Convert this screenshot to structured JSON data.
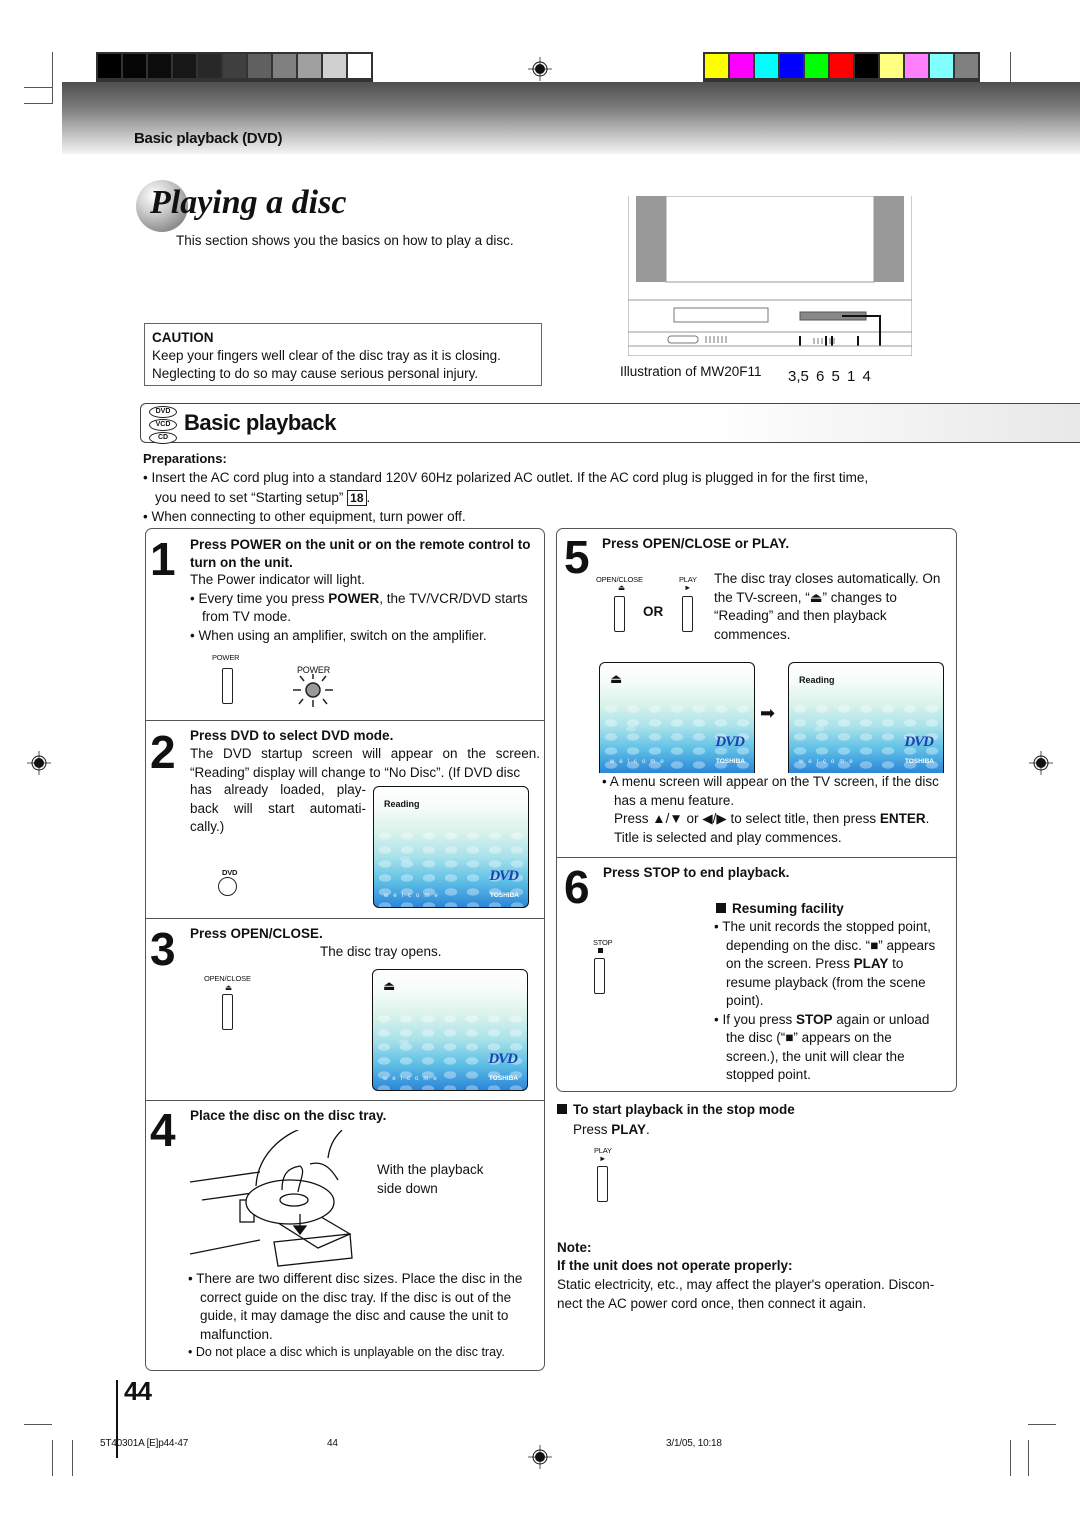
{
  "print_marks": {
    "grayscale_bar": [
      "#000000",
      "#050505",
      "#0c0c0c",
      "#171717",
      "#282828",
      "#404040",
      "#606060",
      "#808080",
      "#a0a0a0",
      "#d0d0d0",
      "#ffffff"
    ],
    "color_bar": [
      "#ffff00",
      "#ff00ff",
      "#00ffff",
      "#0000ff",
      "#00ff00",
      "#ff0000",
      "#000000",
      "#ffff80",
      "#ff80ff",
      "#80ffff",
      "#808080"
    ]
  },
  "header": {
    "section_label": "Basic playback (DVD)"
  },
  "intro": {
    "title": "Playing a disc",
    "subtitle": "This section shows you the basics on how to play a disc."
  },
  "caution": {
    "heading": "CAUTION",
    "line1": "Keep your fingers well clear of the disc tray as it is closing.",
    "line2": "Neglecting to do so may cause serious personal injury."
  },
  "illustration": {
    "caption": "Illustration of MW20F11",
    "callouts": "3,5   6 5 1   4"
  },
  "section": {
    "disc_tags": [
      "DVD",
      "VCD",
      "CD"
    ],
    "title": "Basic playback"
  },
  "preparations": {
    "heading": "Preparations:",
    "item1_a": "Insert the AC cord plug into a standard 120V 60Hz polarized AC outlet. If the AC cord plug is plugged in for the first time,",
    "item1_b": "you need to set “Starting setup”",
    "item1_ref": "18",
    "item2": "When connecting to other equipment, turn power off."
  },
  "steps": {
    "s1": {
      "number": "1",
      "heading_a": "Press POWER on the unit or on the remote control",
      "heading_b": "to turn on the unit",
      "text": "The Power indicator will light.",
      "bullet1_a": "Every time you press ",
      "bullet1_bold": "POWER",
      "bullet1_b": ", the TV/VCR/DVD starts from TV mode.",
      "bullet2": "When using an amplifier, switch on the amplifier.",
      "button_label": "POWER",
      "indicator_label": "POWER"
    },
    "s2": {
      "number": "2",
      "heading": "Press DVD to select DVD mode.",
      "text1": "The DVD startup screen will appear on the screen. “Reading” display will change to “No Disc”. (If DVD disc",
      "text2": "has already loaded, play- back will start automati- cally.)",
      "button_label": "DVD",
      "screen_text": "Reading"
    },
    "s3": {
      "number": "3",
      "heading": "Press OPEN/CLOSE.",
      "text": "The disc tray opens.",
      "button_label": "OPEN/CLOSE",
      "screen_symbol": "⏏"
    },
    "s4": {
      "number": "4",
      "heading": "Place the disc on the disc tray.",
      "caption_a": "With the playback",
      "caption_b": "side down",
      "bullet1": "There are two different disc sizes. Place the disc in the correct guide on the disc tray. If the disc is out of the guide, it may damage the disc and cause the unit to malfunction.",
      "bullet2": "Do not place a disc which is unplayable on the disc tray."
    },
    "s5": {
      "number": "5",
      "heading": "Press OPEN/CLOSE or PLAY.",
      "button1_label": "OPEN/CLOSE",
      "button2_label": "PLAY",
      "or_label": "OR",
      "text": "The disc tray closes automatically. On the TV-screen, “⏏” changes to “Reading” and then playback commences.",
      "screen1_symbol": "⏏",
      "screen2_text": "Reading",
      "bullet_a": "A menu screen will appear on the TV screen, if the disc has a menu feature.",
      "bullet_b1": "Press ▲/▼ or ◀/▶ to select title, then press ",
      "bullet_b_bold": "ENTER",
      "bullet_b2": ".",
      "bullet_c": "Title is selected and play commences."
    },
    "s6": {
      "number": "6",
      "heading": "Press STOP to end playback.",
      "button_label": "STOP",
      "resume_heading": "Resuming facility",
      "r1_a": "The unit records the stopped point, depending on the disc. “■” appears on the screen. Press ",
      "r1_bold": "PLAY",
      "r1_b": " to resume playback (from the scene point).",
      "r2_a": "If you press ",
      "r2_bold": "STOP",
      "r2_b": " again or unload the disc (“■” appears on the screen.), the unit will clear the stopped point."
    }
  },
  "stop_mode": {
    "heading": "To start playback in the stop mode",
    "text_a": "Press ",
    "text_bold": "PLAY",
    "text_b": ".",
    "button_label": "PLAY"
  },
  "note": {
    "label": "Note:",
    "heading": "If the unit does not operate properly:",
    "text": "Static electricity, etc., may affect the player's operation. Discon- nect the AC power cord once, then connect it again."
  },
  "screen_brand": {
    "logo": "DVD",
    "maker": "TOSHIBA",
    "welcome": "welcome"
  },
  "footer": {
    "page_number": "44",
    "file": "5T40301A [E]p44-47",
    "page": "44",
    "timestamp": "3/1/05, 10:18"
  }
}
